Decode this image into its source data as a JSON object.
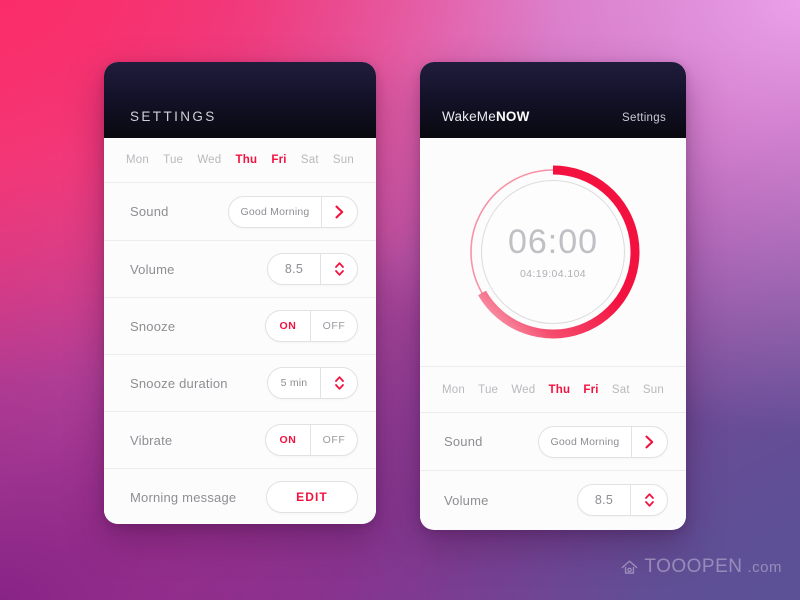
{
  "background": {
    "top_left": "#f5397a",
    "top_right": "#eaa0e8",
    "bottom_left": "#882486",
    "bottom_right": "#5e5194"
  },
  "accent_color": "#f3123f",
  "panel_settings": {
    "header": {
      "title": "SETTINGS"
    },
    "days": [
      {
        "label": "Mon",
        "active": false
      },
      {
        "label": "Tue",
        "active": false
      },
      {
        "label": "Wed",
        "active": false
      },
      {
        "label": "Thu",
        "active": true
      },
      {
        "label": "Fri",
        "active": true
      },
      {
        "label": "Sat",
        "active": false
      },
      {
        "label": "Sun",
        "active": false
      }
    ],
    "rows": {
      "sound": {
        "label": "Sound",
        "value": "Good Morning",
        "icon": "chevron-right-icon"
      },
      "volume": {
        "label": "Volume",
        "value": "8.5",
        "icon": "stepper-updown-icon"
      },
      "snooze": {
        "label": "Snooze",
        "on_label": "ON",
        "off_label": "OFF",
        "state": "ON"
      },
      "snooze_duration": {
        "label": "Snooze duration",
        "value": "5 min",
        "icon": "stepper-updown-icon"
      },
      "vibrate": {
        "label": "Vibrate",
        "on_label": "ON",
        "off_label": "OFF",
        "state": "ON"
      },
      "morning_message": {
        "label": "Morning message",
        "button_label": "EDIT"
      }
    }
  },
  "panel_alarm": {
    "header": {
      "brand_light": "WakeMe",
      "brand_bold": "NOW",
      "settings_link": "Settings"
    },
    "clock": {
      "time": "06:00",
      "countdown": "04:19:04.104",
      "progress_percent": 65
    },
    "days": [
      {
        "label": "Mon",
        "active": false
      },
      {
        "label": "Tue",
        "active": false
      },
      {
        "label": "Wed",
        "active": false
      },
      {
        "label": "Thu",
        "active": true
      },
      {
        "label": "Fri",
        "active": true
      },
      {
        "label": "Sat",
        "active": false
      },
      {
        "label": "Sun",
        "active": false
      }
    ],
    "rows": {
      "sound": {
        "label": "Sound",
        "value": "Good Morning",
        "icon": "chevron-right-icon"
      },
      "volume": {
        "label": "Volume",
        "value": "8.5",
        "icon": "stepper-updown-icon"
      }
    }
  },
  "watermark": {
    "text": "TOOOPEN",
    "suffix": ".com",
    "icon": "home-cloud-icon"
  }
}
